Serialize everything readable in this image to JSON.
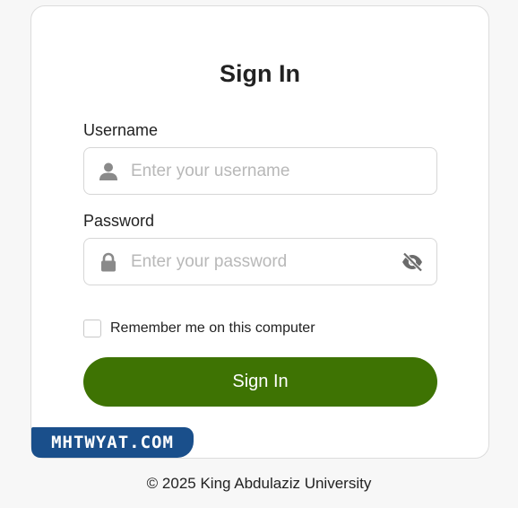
{
  "title": "Sign In",
  "username": {
    "label": "Username",
    "placeholder": "Enter your username",
    "value": "",
    "icon": "user-icon"
  },
  "password": {
    "label": "Password",
    "placeholder": "Enter your password",
    "value": "",
    "icon": "lock-icon",
    "toggle_icon": "eye-slash-icon"
  },
  "remember": {
    "label": "Remember me on this computer",
    "checked": false
  },
  "submit_label": "Sign In",
  "watermark": "MHTWYAT.COM",
  "footer": "© 2025 King Abdulaziz University",
  "colors": {
    "primary_button": "#3e7303",
    "watermark_bg": "#1a4f8b",
    "placeholder": "#b8b8b8"
  }
}
